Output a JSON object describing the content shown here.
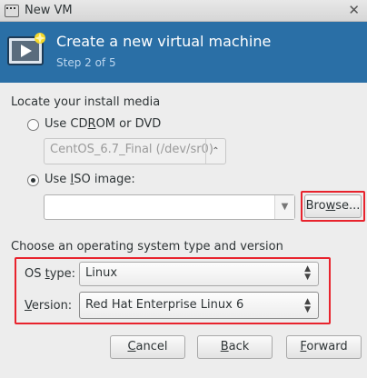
{
  "window": {
    "title": "New VM",
    "close_glyph": "✕"
  },
  "header": {
    "title": "Create a new virtual machine",
    "step": "Step 2 of 5"
  },
  "install_media": {
    "heading": "Locate your install media",
    "cdrom_option": {
      "label_pre": "Use CD",
      "label_u": "R",
      "label_post": "OM or DVD",
      "selected": false
    },
    "cdrom_value": "CentOS_6.7_Final (/dev/sr0)",
    "iso_option": {
      "label_pre": "Use ",
      "label_u": "I",
      "label_post": "SO image:",
      "selected": true
    },
    "iso_path_value": "",
    "browse_pre": "Bro",
    "browse_u": "w",
    "browse_post": "se..."
  },
  "os": {
    "heading": "Choose an operating system type and version",
    "type_label_pre": "OS ",
    "type_label_u": "t",
    "type_label_post": "ype:",
    "type_value": "Linux",
    "version_label_u": "V",
    "version_label_post": "ersion:",
    "version_value": "Red Hat Enterprise Linux 6"
  },
  "footer": {
    "cancel_u": "C",
    "cancel_post": "ancel",
    "back_u": "B",
    "back_post": "ack",
    "forward_u": "F",
    "forward_post": "orward"
  },
  "colors": {
    "banner": "#2a6fa6",
    "highlight": "#e8232d"
  }
}
